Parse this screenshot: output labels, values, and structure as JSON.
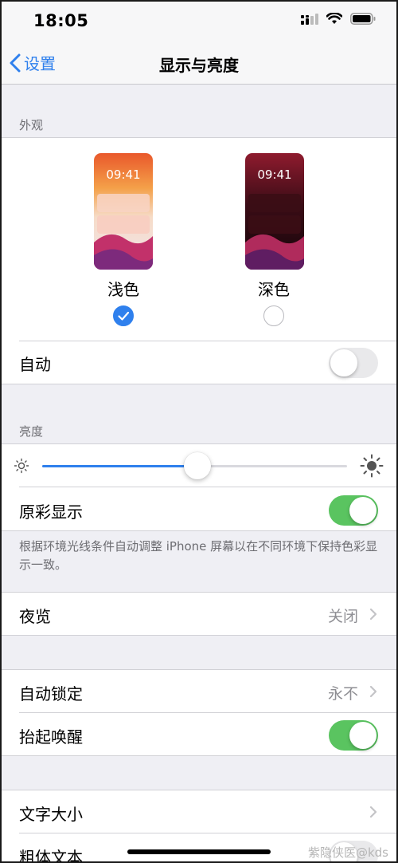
{
  "status_bar": {
    "time": "18:05"
  },
  "nav": {
    "back_label": "设置",
    "title": "显示与亮度"
  },
  "appearance": {
    "header": "外观",
    "light": {
      "preview_time": "09:41",
      "label": "浅色",
      "selected": true
    },
    "dark": {
      "preview_time": "09:41",
      "label": "深色",
      "selected": false
    },
    "auto": {
      "label": "自动",
      "enabled": false
    }
  },
  "brightness": {
    "header": "亮度",
    "level": 0.51,
    "true_tone": {
      "label": "原彩显示",
      "enabled": true
    },
    "footer": "根据环境光线条件自动调整 iPhone 屏幕以在不同环境下保持色彩显示一致。"
  },
  "night_shift": {
    "label": "夜览",
    "value": "关闭"
  },
  "lock_group": {
    "auto_lock": {
      "label": "自动锁定",
      "value": "永不"
    },
    "raise_to_wake": {
      "label": "抬起唤醒",
      "enabled": true
    }
  },
  "text_group": {
    "text_size": {
      "label": "文字大小"
    },
    "bold_text": {
      "label": "粗体文本",
      "enabled": false
    }
  },
  "watermark": "紫隐侠医@kds",
  "colors": {
    "accent": "#2f80ed",
    "toggle_on": "#5ac460",
    "background": "#efeff4"
  },
  "icons": [
    "cellular-signal-icon",
    "wifi-icon",
    "battery-icon",
    "chevron-left-icon",
    "checkmark-icon",
    "sun-small-icon",
    "sun-large-icon",
    "chevron-right-icon"
  ]
}
